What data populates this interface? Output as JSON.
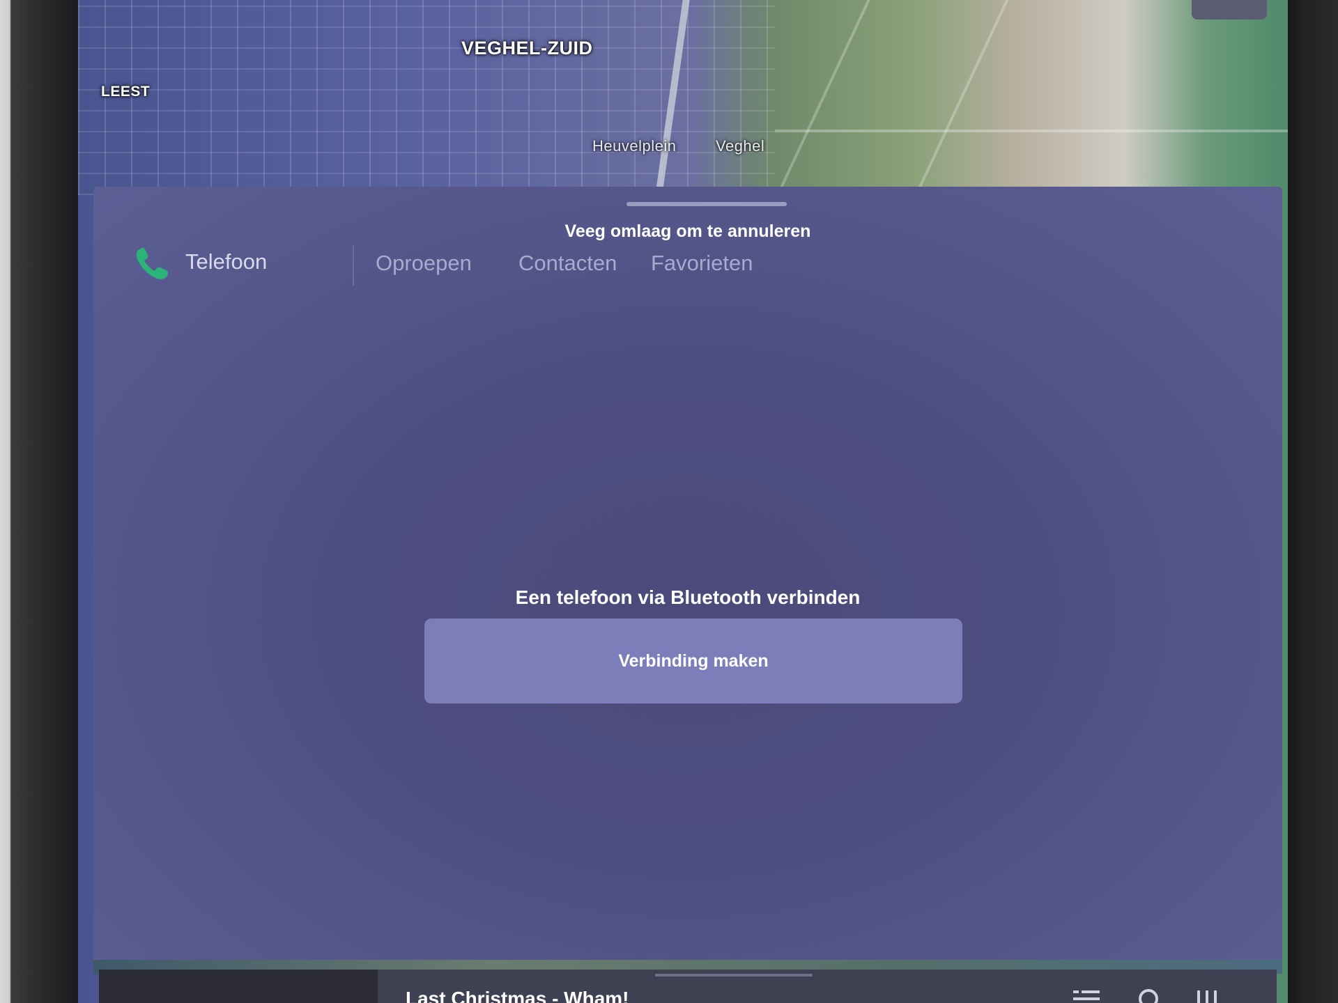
{
  "map": {
    "labels": {
      "district": "VEGHEL-ZUID",
      "leest": "LEEST",
      "heuvelplein": "Heuvelplein",
      "veghel": "Veghel"
    }
  },
  "phone_panel": {
    "swipe_hint": "Veeg omlaag om te annuleren",
    "title": "Telefoon",
    "tabs": [
      {
        "label": "Oproepen"
      },
      {
        "label": "Contacten"
      },
      {
        "label": "Favorieten"
      }
    ],
    "connect_prompt": "Een telefoon via Bluetooth verbinden",
    "connect_button": "Verbinding maken"
  },
  "media": {
    "now_playing": "Last Christmas - Wham!",
    "icons": [
      "playlist-icon",
      "search-icon",
      "equalizer-icon"
    ]
  },
  "colors": {
    "accent_phone": "#2bb37a",
    "panel_bg": "#4e4d80",
    "button_bg": "#7b7eb8"
  }
}
